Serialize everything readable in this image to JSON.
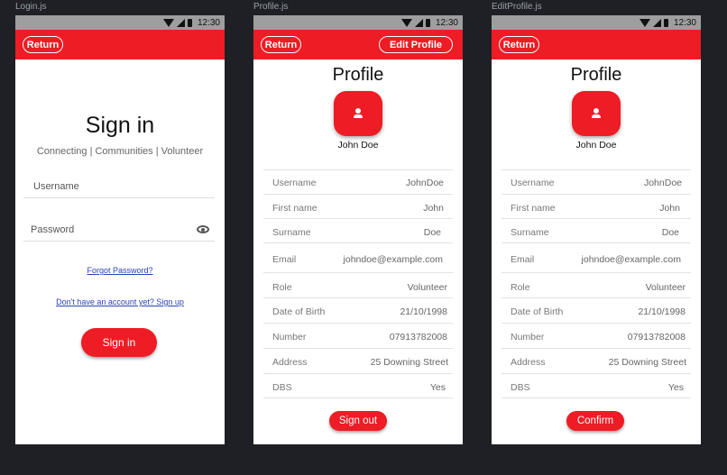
{
  "frames": [
    {
      "label": "Login.js"
    },
    {
      "label": "Profile.js"
    },
    {
      "label": "EditProfile.js"
    }
  ],
  "status_bar": {
    "time": "12:30"
  },
  "login": {
    "return_label": "Return",
    "title": "Sign in",
    "subtitle": "Connecting | Communities | Volunteer",
    "username_placeholder": "Username",
    "password_placeholder": "Password",
    "forgot_link": "Forgot Password?",
    "signup_link": "Don't have an account yet? Sign up",
    "signin_button": "Sign in"
  },
  "profile": {
    "return_label": "Return",
    "edit_label": "Edit Profile",
    "title": "Profile",
    "name": "John Doe",
    "fields": [
      {
        "label": "Username",
        "value": "JohnDoe"
      },
      {
        "label": "First name",
        "value": "John"
      },
      {
        "label": "Surname",
        "value": "Doe"
      },
      {
        "label": "Email",
        "value": "johndoe@example.com"
      },
      {
        "label": "Role",
        "value": "Volunteer"
      },
      {
        "label": "Date of Birth",
        "value": "21/10/1998"
      },
      {
        "label": "Number",
        "value": "07913782008"
      },
      {
        "label": "Address",
        "value": "25 Downing Street"
      },
      {
        "label": "DBS",
        "value": "Yes"
      }
    ],
    "signout_button": "Sign out"
  },
  "edit_profile": {
    "return_label": "Return",
    "title": "Profile",
    "name": "John Doe",
    "fields": [
      {
        "label": "Username",
        "value": "JohnDoe"
      },
      {
        "label": "First name",
        "value": "John"
      },
      {
        "label": "Surname",
        "value": "Doe"
      },
      {
        "label": "Email",
        "value": "johndoe@example.com"
      },
      {
        "label": "Role",
        "value": "Volunteer"
      },
      {
        "label": "Date of Birth",
        "value": "21/10/1998"
      },
      {
        "label": "Number",
        "value": "07913782008"
      },
      {
        "label": "Address",
        "value": "25 Downing Street"
      },
      {
        "label": "DBS",
        "value": "Yes"
      }
    ],
    "confirm_button": "Confirm"
  },
  "colors": {
    "accent": "#ee1c24",
    "background": "#1e2026",
    "status_bar": "#9e9e9e",
    "link": "#2a44b8"
  }
}
